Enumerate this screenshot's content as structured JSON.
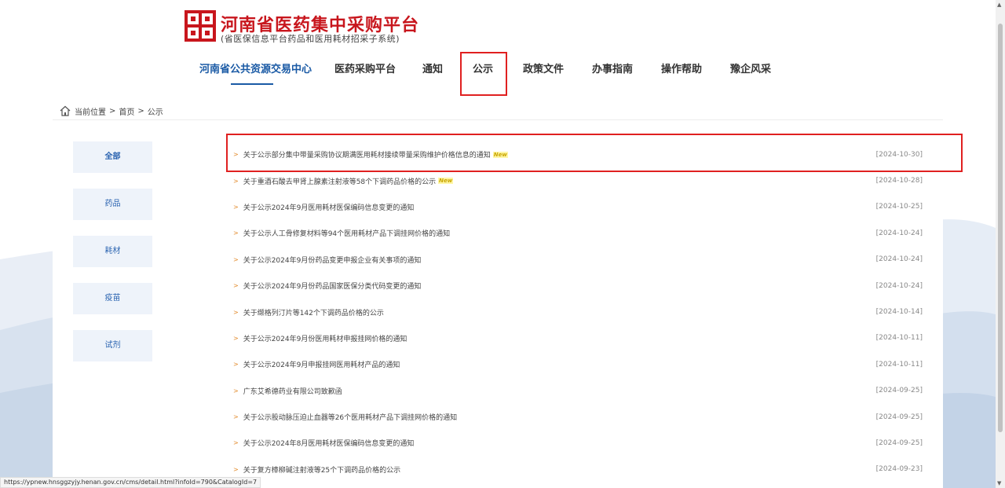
{
  "header": {
    "title": "河南省医药集中采购平台",
    "subtitle": "(省医保信息平台药品和医用耗材招采子系统)"
  },
  "nav": {
    "items": [
      {
        "label": "河南省公共资源交易中心"
      },
      {
        "label": "医药采购平台"
      },
      {
        "label": "通知"
      },
      {
        "label": "公示"
      },
      {
        "label": "政策文件"
      },
      {
        "label": "办事指南"
      },
      {
        "label": "操作帮助"
      },
      {
        "label": "豫企风采"
      }
    ],
    "active": "河南省公共资源交易中心"
  },
  "breadcrumb": {
    "prefix": "当前位置",
    "sep1": ">",
    "home": "首页",
    "sep2": ">",
    "current": "公示"
  },
  "sidebar": {
    "items": [
      {
        "label": "全部"
      },
      {
        "label": "药品"
      },
      {
        "label": "耗材"
      },
      {
        "label": "疫苗"
      },
      {
        "label": "试剂"
      }
    ]
  },
  "list": {
    "new_badge": "New",
    "arrow": ">",
    "items": [
      {
        "title": "关于公示部分集中带量采购协议期满医用耗材接续带量采购维护价格信息的通知",
        "date": "[2024-10-30]",
        "is_new": true
      },
      {
        "title": "关于重酒石酸去甲肾上腺素注射液等58个下调药品价格的公示",
        "date": "[2024-10-28]",
        "is_new": true
      },
      {
        "title": "关于公示2024年9月医用耗材医保编码信息变更的通知",
        "date": "[2024-10-25]",
        "is_new": false
      },
      {
        "title": "关于公示人工骨修复材料等94个医用耗材产品下调挂网价格的通知",
        "date": "[2024-10-24]",
        "is_new": false
      },
      {
        "title": "关于公示2024年9月份药品变更申报企业有关事项的通知",
        "date": "[2024-10-24]",
        "is_new": false
      },
      {
        "title": "关于公示2024年9月份药品国家医保分类代码变更的通知",
        "date": "[2024-10-24]",
        "is_new": false
      },
      {
        "title": "关于缬格列汀片等142个下调药品价格的公示",
        "date": "[2024-10-14]",
        "is_new": false
      },
      {
        "title": "关于公示2024年9月份医用耗材申报挂网价格的通知",
        "date": "[2024-10-11]",
        "is_new": false
      },
      {
        "title": "关于公示2024年9月申报挂网医用耗材产品的通知",
        "date": "[2024-10-11]",
        "is_new": false
      },
      {
        "title": "广东艾希德药业有限公司致歉函",
        "date": "[2024-09-25]",
        "is_new": false
      },
      {
        "title": "关于公示股动脉压迫止血器等26个医用耗材产品下调挂网价格的通知",
        "date": "[2024-09-25]",
        "is_new": false
      },
      {
        "title": "关于公示2024年8月医用耗材医保编码信息变更的通知",
        "date": "[2024-09-25]",
        "is_new": false
      },
      {
        "title": "关于复方樟柳碱注射液等25个下调药品价格的公示",
        "date": "[2024-09-23]",
        "is_new": false
      }
    ]
  },
  "status_bar": {
    "url": "https://ypnew.hnsggzyjy.henan.gov.cn/cms/detail.html?infoId=790&CatalogId=7"
  },
  "colors": {
    "brand_red": "#c8161d",
    "nav_blue": "#1a5aa5",
    "highlight_red": "#e02020",
    "arrow_orange": "#e28a2b"
  }
}
